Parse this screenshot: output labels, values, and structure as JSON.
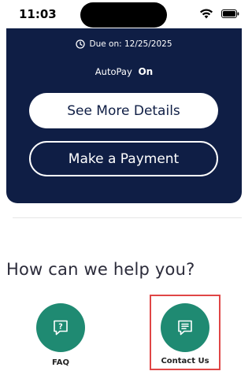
{
  "status_bar": {
    "time": "11:03"
  },
  "bill_card": {
    "due_text": "Due on: 12/25/2025",
    "autopay_label": "AutoPay",
    "autopay_value": "On",
    "see_more_label": "See More Details",
    "make_payment_label": "Make a Payment",
    "background_color": "#0f1e45"
  },
  "help": {
    "title": "How can we help you?",
    "items": [
      {
        "label": "FAQ",
        "icon": "faq-question-icon"
      },
      {
        "label": "Contact Us",
        "icon": "chat-message-icon"
      }
    ],
    "accent_color": "#1f8a72",
    "highlight_color": "#e04646"
  }
}
